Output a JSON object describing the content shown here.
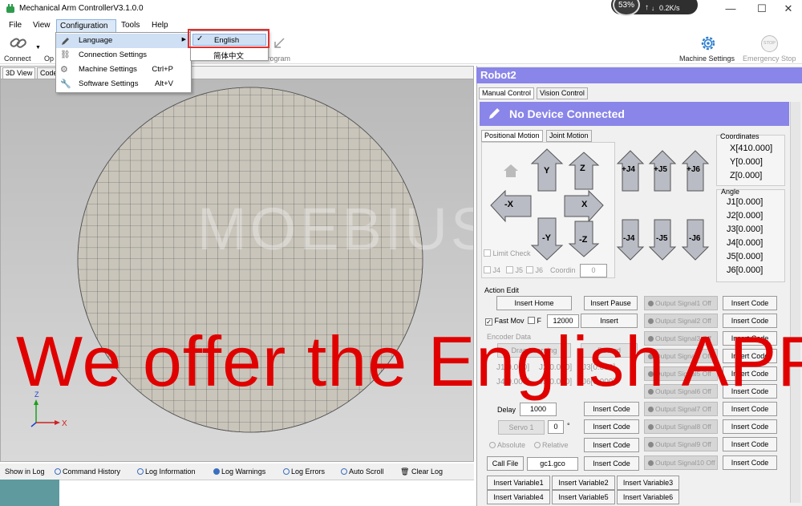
{
  "window": {
    "title": "Mechanical Arm ControllerV3.1.0.0",
    "net_percent": "53%",
    "net_speed": "0.2K/s",
    "minimize": "—",
    "maximize": "☐",
    "close": "✕"
  },
  "menubar": {
    "file": "File",
    "view": "View",
    "configuration": "Configuration",
    "tools": "Tools",
    "help": "Help"
  },
  "config_menu": {
    "language": "Language",
    "connection_settings": "Connection Settings",
    "machine_settings": "Machine Settings",
    "machine_settings_shortcut": "Ctrl+P",
    "software_settings": "Software Settings",
    "software_settings_shortcut": "Alt+V"
  },
  "language_menu": {
    "english": "English",
    "chinese": "简体中文"
  },
  "toolbar": {
    "connect": "Connect",
    "open": "Op",
    "send_program": "d Program",
    "machine_settings": "Machine Settings",
    "emergency_stop": "Emergency Stop",
    "stop_icon_text": "STOP"
  },
  "left_tabs": {
    "view3d": "3D View",
    "code": "Code"
  },
  "watermark": "MOEBIUS",
  "axis": {
    "z": "Z",
    "x": "X"
  },
  "log": {
    "show_in_log": "Show in Log",
    "command_history": "Command History",
    "log_information": "Log Information",
    "log_warnings": "Log Warnings",
    "log_errors": "Log Errors",
    "auto_scroll": "Auto Scroll",
    "clear_log": "Clear Log"
  },
  "robot": {
    "name": "Robot2",
    "tabs": [
      "Manual Control",
      "Vision Control"
    ],
    "status": "No Device Connected",
    "motion_tabs": [
      "Positional Motion",
      "Joint Motion"
    ],
    "arrows": {
      "y_up": "Y",
      "z_up": "Z",
      "x_left": "-X",
      "x_right": "X",
      "y_down": "-Y",
      "z_down": "-Z",
      "j4_up": "+J4",
      "j5_up": "+J5",
      "j6_up": "+J6",
      "j4_down": "-J4",
      "j5_down": "-J5",
      "j6_down": "-J6"
    },
    "limit_check": "Limit Check",
    "j4": "J4",
    "j5": "J5",
    "j6": "J6",
    "coordin": "Coordin",
    "coordin_value": "0",
    "coordinates_title": "Coordinates",
    "coordinates": [
      "X[410.000]",
      "Y[0.000]",
      "Z[0.000]"
    ],
    "angle_title": "Angle",
    "angles": [
      "J1[0.000]",
      "J2[0.000]",
      "J3[0.000]",
      "J4[0.000]",
      "J5[0.000]",
      "J6[0.000]"
    ]
  },
  "action": {
    "title": "Action Edit",
    "insert_home": "Insert Home",
    "insert_pause": "Insert Pause",
    "fast_move": "Fast Mov",
    "f_label": "F",
    "f_value": "12000",
    "insert": "Insert",
    "encoder_data": "Encoder Data",
    "drag_learning": "Drag Learning",
    "record": "Record",
    "enc_j1": "J1[0.000]",
    "enc_j2": "J2[0.000]",
    "enc_j3": "J3[0.000]",
    "enc_j4": "J4[0.000]",
    "enc_j5": "J5[0.000]",
    "enc_j6": "J6[0.000]",
    "delay": "Delay",
    "delay_value": "1000",
    "servo": "Servo 1",
    "servo_value": "0",
    "degree": "°",
    "absolute": "Absolute",
    "relative": "Relative",
    "call_file": "Call File",
    "call_file_value": "gc1.gco",
    "insert_code": "Insert Code",
    "signals": [
      "Output Signal1 Off",
      "Output Signal2 Off",
      "Output Signal3 Off",
      "Output Signal4 Off",
      "Output Signal5 Off",
      "Output Signal6 Off",
      "Output Signal7 Off",
      "Output Signal8 Off",
      "Output Signal9 Off",
      "Output Signal10 Off"
    ],
    "variables": [
      "Insert Variable1",
      "Insert Variable2",
      "Insert Variable3",
      "Insert Variable4",
      "Insert Variable5",
      "Insert Variable6"
    ]
  },
  "overlay": "We offer the English APP",
  "colors": {
    "accent": "#8a85e8",
    "overlay_red": "#e00000",
    "highlight_box": "#e03030",
    "work_area": "#c9c5bb"
  }
}
